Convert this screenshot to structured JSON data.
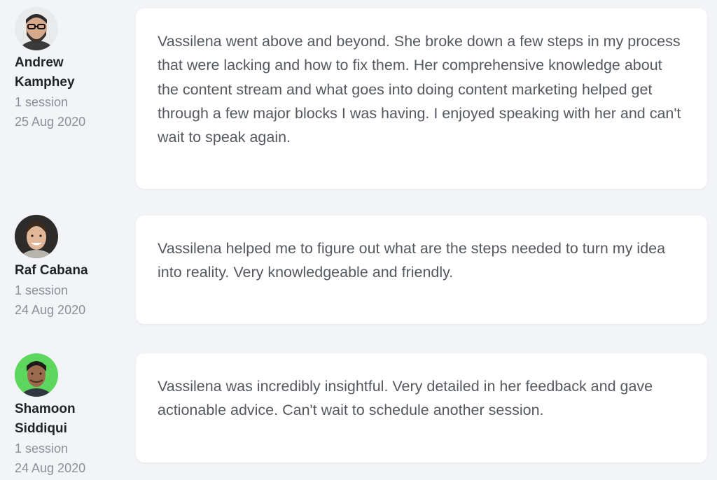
{
  "reviews": [
    {
      "name_line1": "Andrew",
      "name_line2": "Kamphey",
      "sessions": "1 session",
      "date": "25 Aug 2020",
      "avatar_icon": "bearded-man-glasses-avatar",
      "text": "Vassilena went above and beyond. She broke down a few steps in my process that were lacking and how to fix them. Her comprehensive knowledge about the content stream and what goes into doing content marketing helped get through a few major blocks I was having. I enjoyed speaking with her and can't wait to speak again."
    },
    {
      "name_line1": "Raf Cabana",
      "name_line2": "",
      "sessions": "1 session",
      "date": "24 Aug 2020",
      "avatar_icon": "smiling-man-avatar",
      "text": "Vassilena helped me to figure out what are the steps needed to turn my idea into reality. Very knowledgeable and friendly."
    },
    {
      "name_line1": "Shamoon",
      "name_line2": "Siddiqui",
      "sessions": "1 session",
      "date": "24 Aug 2020",
      "avatar_icon": "man-green-background-avatar",
      "text": "Vassilena was incredibly insightful. Very detailed in her feedback and gave actionable advice. Can't wait to schedule another session."
    }
  ],
  "colors": {
    "page_background": "#f3f4f7",
    "card_background": "#ffffff",
    "name_text": "#1f2328",
    "meta_text": "#8a8f98",
    "body_text": "#55595f",
    "avatar3_background": "#5cd65c"
  }
}
